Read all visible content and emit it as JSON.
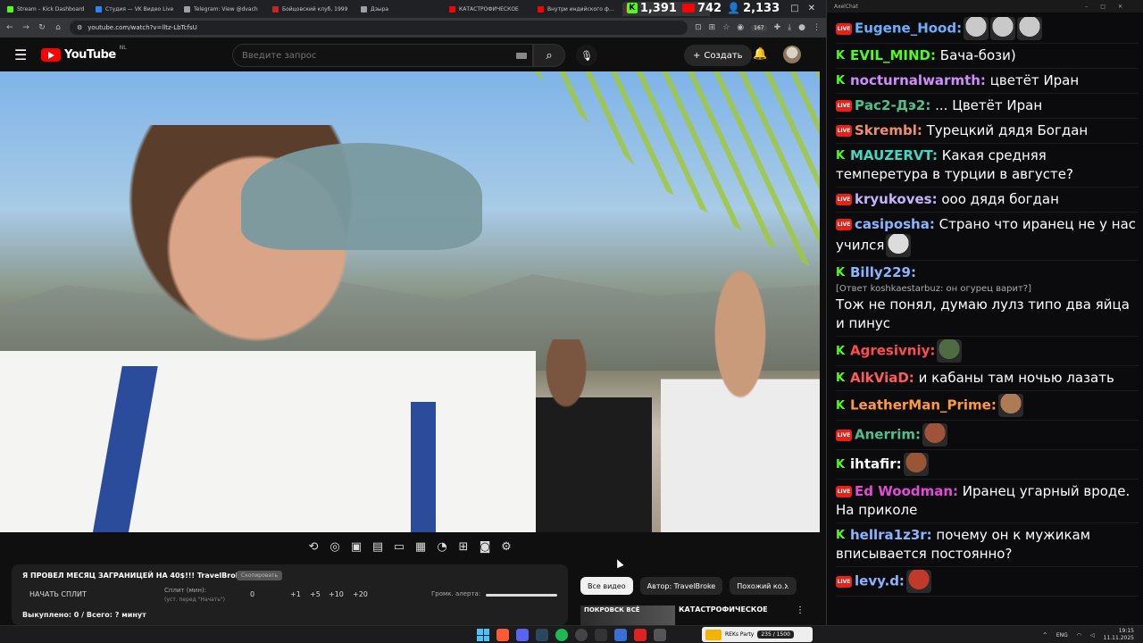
{
  "browser": {
    "tabs": [
      {
        "label": "Stream – Kick Dashboard",
        "color": "#53fc18",
        "active": false
      },
      {
        "label": "Студия — VK Видео Live",
        "color": "#2787f5",
        "active": false
      },
      {
        "label": "Telegram: View @dvach",
        "color": "#9aa0a6",
        "active": false
      },
      {
        "label": "Бойцовский клуб, 1999",
        "color": "#cc2222",
        "active": false
      },
      {
        "label": "Дзыра",
        "color": "#9aa0a6",
        "active": false
      },
      {
        "label": "КАТАСТРОФИЧЕСКОЕ",
        "color": "#ff0000",
        "active": false
      },
      {
        "label": "Внутри индийского ф…",
        "color": "#ff0000",
        "active": false
      },
      {
        "label": "",
        "color": "#ff0000",
        "active": true
      }
    ],
    "url": "youtube.com/watch?v=lltz-LbTcfsU",
    "ext_badge": "167"
  },
  "stats": {
    "kick_viewers": "1,391",
    "youtube_viewers": "742",
    "total_viewers": "2,133"
  },
  "youtube": {
    "logo_text": "YouTube",
    "logo_region": "NL",
    "search_placeholder": "Введите запрос",
    "create_label": "Создать"
  },
  "split_panel": {
    "title": "Я ПРОВЕЛ МЕСЯЦ ЗАГРАНИЦЕЙ НА 40$!!! TravelBroke1.3",
    "copy_label": "Скопировать",
    "start_label": "НАЧАТЬ СПЛИТ",
    "split_label": "Сплит (мин):",
    "split_sub": "(уст. перед \"Начать\")",
    "split_value": "0",
    "increments": [
      "+1",
      "+5",
      "+10",
      "+20"
    ],
    "alert_label": "Громк. алерта:",
    "bought_text": "Выкуплено: 0 / Всего: ? минут"
  },
  "chips": [
    "Все видео",
    "Автор: TravelBroke",
    "Похожий ко…"
  ],
  "related": {
    "thumb_text": "ПОКРОВСК ВСЁ",
    "title": "КАТАСТРОФИЧЕСКОЕ"
  },
  "chat": {
    "window_title": "AxelChat",
    "messages": [
      {
        "platform": "live",
        "user": "Eugene_Hood:",
        "color": "#6ab0ff",
        "text": "",
        "emote": "#c9c9c9",
        "emote_count": 3
      },
      {
        "platform": "kick",
        "user": "EVIL_MIND:",
        "color": "#53fc18",
        "text": " Бача-бози)"
      },
      {
        "platform": "kick",
        "user": "nocturnalwarmth:",
        "color": "#d08cff",
        "text": " цветёт Иран"
      },
      {
        "platform": "live",
        "user": "Рас2-Дэ2:",
        "color": "#4fc08d",
        "text": " ... Цветёт Иран"
      },
      {
        "platform": "live",
        "user": "Skrembl:",
        "color": "#f08d6b",
        "text": " Турецкий дядя Богдан"
      },
      {
        "platform": "kick",
        "user": "MAUZERVT:",
        "color": "#3fd8c0",
        "text": " Какая средняя темперетура в турции в августе?"
      },
      {
        "platform": "live",
        "user": "kryukoves:",
        "color": "#c6b3ff",
        "text": " ооо дядя богдан"
      },
      {
        "platform": "live",
        "user": "casiposha:",
        "color": "#8ab4ff",
        "text": " Страно что иранец не у нас учился",
        "emote": "#dcdcdc",
        "emote_count": 1
      },
      {
        "platform": "kick",
        "user": "Billy229:",
        "color": "#8ab4ff",
        "reply": "[Ответ koshkaestarbuz: он огурец варит?]",
        "text": " Тож не понял, думаю лулз типо два яйца и пинус"
      },
      {
        "platform": "kick",
        "user": "Agresivniy:",
        "color": "#ff4d4d",
        "text": "",
        "emote": "#4f6b44",
        "emote_count": 1
      },
      {
        "platform": "kick",
        "user": "AlkViaD:",
        "color": "#ff5b5b",
        "text": " и кабаны там ночью лазать"
      },
      {
        "platform": "kick",
        "user": "LeatherMan_Prime:",
        "color": "#ff9a3c",
        "text": "",
        "emote": "#b07a55",
        "emote_count": 1
      },
      {
        "platform": "live",
        "user": "Anerrim:",
        "color": "#4fc08d",
        "text": "",
        "emote": "#a0523a",
        "emote_count": 1
      },
      {
        "platform": "kick",
        "user": "ihtafir:",
        "color": "#ffffff",
        "text": "",
        "emote": "#9a5535",
        "emote_count": 1
      },
      {
        "platform": "live",
        "user": "Ed Woodman:",
        "color": "#e34bd7",
        "text": " Иранец угарный вроде. На приколе"
      },
      {
        "platform": "kick",
        "user": "hellra1z3r:",
        "color": "#8ab4ff",
        "text": " почему он к мужикам вписывается постоянно?"
      },
      {
        "platform": "live",
        "user": "levy.d:",
        "color": "#8ab4ff",
        "text": "",
        "emote": "#c0392b",
        "emote_count": 1
      }
    ]
  },
  "taskbar": {
    "lang": "ENG",
    "time": "19:15",
    "date": "11.11.2025",
    "rec_text": "REKs Party",
    "rec_count": "235 / 1500"
  }
}
